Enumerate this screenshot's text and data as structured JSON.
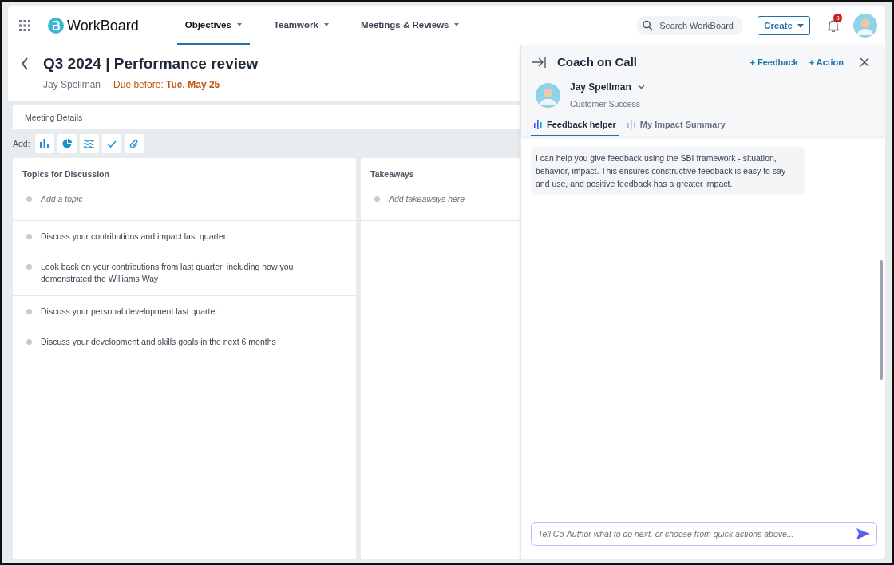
{
  "app": {
    "logo": "WorkBoard",
    "nav": [
      {
        "label": "Objectives",
        "selected": true
      },
      {
        "label": "Teamwork",
        "selected": false
      },
      {
        "label": "Meetings & Reviews",
        "selected": false
      }
    ],
    "search": {
      "placeholder": "Search WorkBoard"
    },
    "create": "Create",
    "notifications": "3"
  },
  "page": {
    "title": "Q3 2024 | Performance review",
    "person": "Jay Spellman",
    "separator": "·",
    "due_label": "Due before: **Tue, May 25**",
    "section": "Meeting Details",
    "add_label": "Add:",
    "add_tools": [
      {
        "kind": "bar"
      },
      {
        "kind": "pie"
      },
      {
        "kind": "wave"
      },
      {
        "kind": "check"
      },
      {
        "kind": "clip"
      }
    ],
    "columns": [
      {
        "title": "Topics for Discussion",
        "placeholder": "Add a topic",
        "items": [
          "Discuss your contributions and impact last quarter",
          "Look back on your contributions from last quarter, including how you demonstrated the Williams Way",
          "Discuss your personal development last quarter",
          "Discuss your development and skills goals in the next 6 months"
        ]
      },
      {
        "title": "Takeaways",
        "placeholder": "Add takeaways here"
      }
    ]
  },
  "panel": {
    "title": "Coach on Call",
    "actions": [
      "+ Feedback",
      "+ Action"
    ],
    "person": "Jay Spellman",
    "team": "Customer Success",
    "tabs": [
      {
        "label": "Feedback helper",
        "selected": true
      },
      {
        "label": "My Impact Summary",
        "selected": false
      }
    ],
    "messages": [
      "I can help you give feedback using the SBI framework - situation, behavior, impact. This ensures constructive feedback is easy to say and use, and positive feedback has a greater impact."
    ],
    "input": {
      "placeholder": "Tell Co-Author what to do next, or choose from quick actions above..."
    }
  }
}
